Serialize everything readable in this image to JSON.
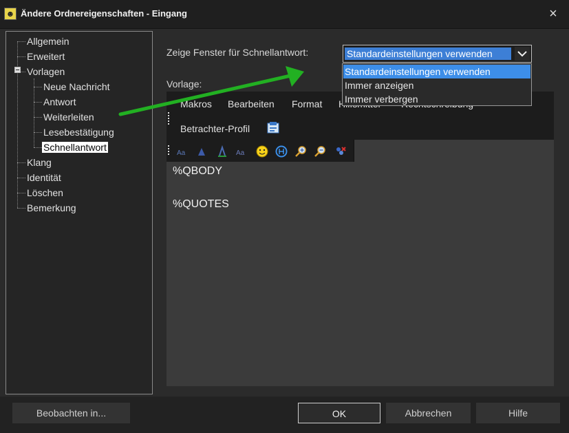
{
  "window": {
    "title": "Ändere Ordnereigenschaften - Eingang",
    "close_icon": "×"
  },
  "tree": {
    "items": [
      {
        "label": "Allgemein"
      },
      {
        "label": "Erweitert"
      },
      {
        "label": "Vorlagen"
      },
      {
        "label": "Neue Nachricht"
      },
      {
        "label": "Antwort"
      },
      {
        "label": "Weiterleiten"
      },
      {
        "label": "Lesebestätigung"
      },
      {
        "label": "Schnellantwort"
      },
      {
        "label": "Klang"
      },
      {
        "label": "Identität"
      },
      {
        "label": "Löschen"
      },
      {
        "label": "Bemerkung"
      }
    ]
  },
  "quick_reply": {
    "label": "Zeige Fenster für Schnellantwort:",
    "selected": "Standardeinstellungen verwenden",
    "options": [
      "Standardeinstellungen verwenden",
      "Immer anzeigen",
      "Immer verbergen"
    ]
  },
  "template": {
    "label": "Vorlage:",
    "menu": [
      "Makros",
      "Bearbeiten",
      "Format",
      "Hilfsmittel",
      "Rechtschreibung"
    ],
    "viewer_profile": "Betrachter-Profil",
    "body_lines": [
      "%QBODY",
      "%QUOTES"
    ]
  },
  "buttons": {
    "observe": "Beobachten in...",
    "ok": "OK",
    "cancel": "Abbrechen",
    "help": "Hilfe"
  },
  "colors": {
    "accent": "#3d7fd6",
    "annotation_arrow": "#22b022"
  }
}
